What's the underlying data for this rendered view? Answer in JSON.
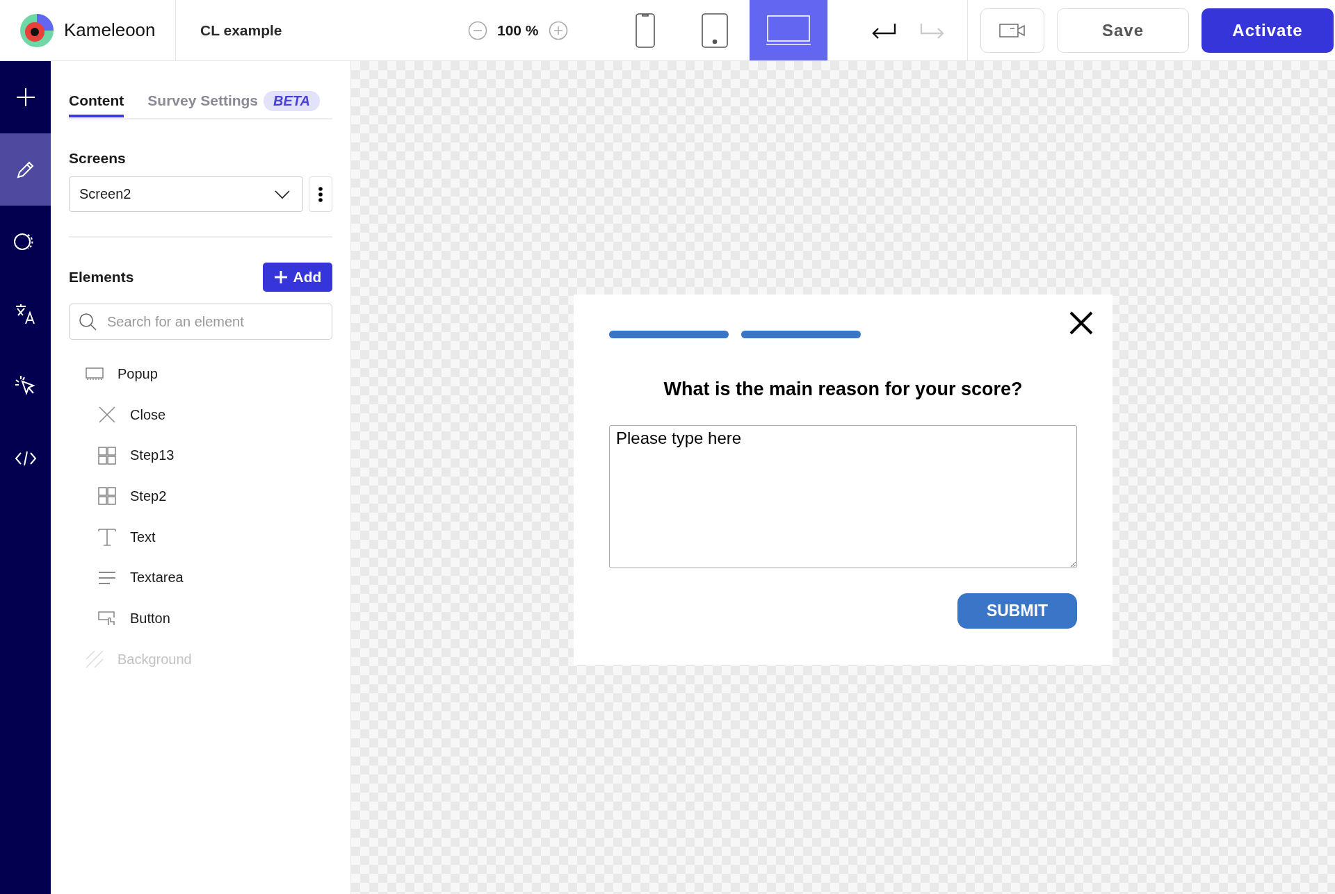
{
  "brand": {
    "name": "Kameleoon"
  },
  "project": {
    "title": "CL example"
  },
  "zoom": {
    "value": "100 %"
  },
  "devices": [
    {
      "kind": "mobile",
      "selected": false
    },
    {
      "kind": "tablet",
      "selected": false
    },
    {
      "kind": "desktop",
      "selected": true
    }
  ],
  "history": [
    {
      "kind": "undo",
      "disabled": false
    },
    {
      "kind": "redo",
      "disabled": true
    }
  ],
  "actions": {
    "save": "Save",
    "activate": "Activate"
  },
  "rail": [
    {
      "kind": "add",
      "selected": false
    },
    {
      "kind": "edit",
      "selected": true
    },
    {
      "kind": "targeting",
      "selected": false
    },
    {
      "kind": "translate",
      "selected": false
    },
    {
      "kind": "click",
      "selected": false
    },
    {
      "kind": "code",
      "selected": false
    }
  ],
  "tabs": [
    {
      "label": "Content",
      "selected": true
    },
    {
      "label": "Survey Settings",
      "selected": false,
      "badge": "BETA"
    }
  ],
  "screens": {
    "heading": "Screens",
    "value": "Screen2"
  },
  "elements": {
    "heading": "Elements",
    "add_label": "Add",
    "search_placeholder": "Search for an element",
    "tree": [
      {
        "label": "Popup",
        "kind": "popup",
        "disabled": false,
        "children": [
          {
            "label": "Close",
            "kind": "close",
            "disabled": false
          },
          {
            "label": "Step13",
            "kind": "step",
            "disabled": false
          },
          {
            "label": "Step2",
            "kind": "step",
            "disabled": false
          },
          {
            "label": "Text",
            "kind": "text",
            "disabled": false
          },
          {
            "label": "Textarea",
            "kind": "textarea",
            "disabled": false
          },
          {
            "label": "Button",
            "kind": "button",
            "disabled": false
          }
        ]
      },
      {
        "label": "Background",
        "kind": "background",
        "disabled": true
      }
    ]
  },
  "popup": {
    "progress": [
      {
        "filled": true
      },
      {
        "filled": true
      }
    ],
    "question": "What is the main reason for your score?",
    "textarea_value": "Please type here",
    "submit": "SUBMIT"
  }
}
